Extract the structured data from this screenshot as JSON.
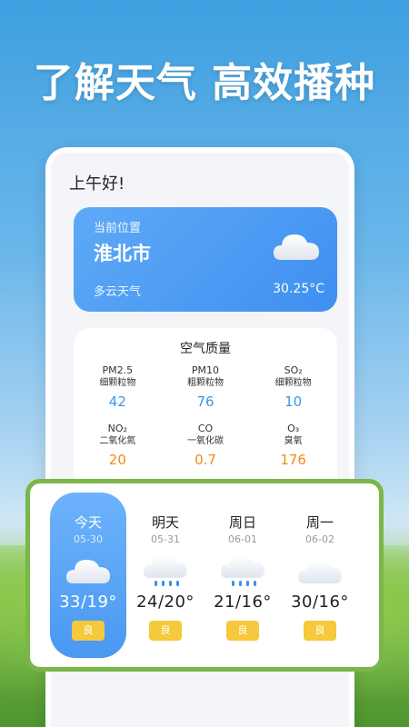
{
  "headline": "了解天气 高效播种",
  "greeting": "上午好!",
  "location": {
    "label": "当前位置",
    "city": "淮北市",
    "weather": "多云天气",
    "temperature": "30.25°C",
    "icon": "cloud-icon"
  },
  "air_quality": {
    "title": "空气质量",
    "items": [
      {
        "name": "PM2.5",
        "desc": "细颗粒物",
        "value": "42",
        "color": "#3b97e6"
      },
      {
        "name": "PM10",
        "desc": "粗颗粒物",
        "value": "76",
        "color": "#3b97e6"
      },
      {
        "name": "SO₂",
        "desc": "细颗粒物",
        "value": "10",
        "color": "#3b97e6"
      },
      {
        "name": "NO₂",
        "desc": "二氧化氮",
        "value": "20",
        "color": "#f28a1b"
      },
      {
        "name": "CO",
        "desc": "一氧化碳",
        "value": "0.7",
        "color": "#f28a1b"
      },
      {
        "name": "O₃",
        "desc": "臭氧",
        "value": "176",
        "color": "#f28a1b"
      }
    ]
  },
  "forecast": [
    {
      "day": "今天",
      "date": "05-30",
      "temp": "33/19°",
      "quality": "良",
      "icon": "cloud-icon",
      "selected": true
    },
    {
      "day": "明天",
      "date": "05-31",
      "temp": "24/20°",
      "quality": "良",
      "icon": "rain-cloud-icon",
      "selected": false
    },
    {
      "day": "周日",
      "date": "06-01",
      "temp": "21/16°",
      "quality": "良",
      "icon": "rain-cloud-icon",
      "selected": false
    },
    {
      "day": "周一",
      "date": "06-02",
      "temp": "30/16°",
      "quality": "良",
      "icon": "cloud-icon",
      "selected": false
    }
  ],
  "colors": {
    "accent": "#4a98f2",
    "badge": "#f6c83b",
    "frame": "#7ab648"
  }
}
